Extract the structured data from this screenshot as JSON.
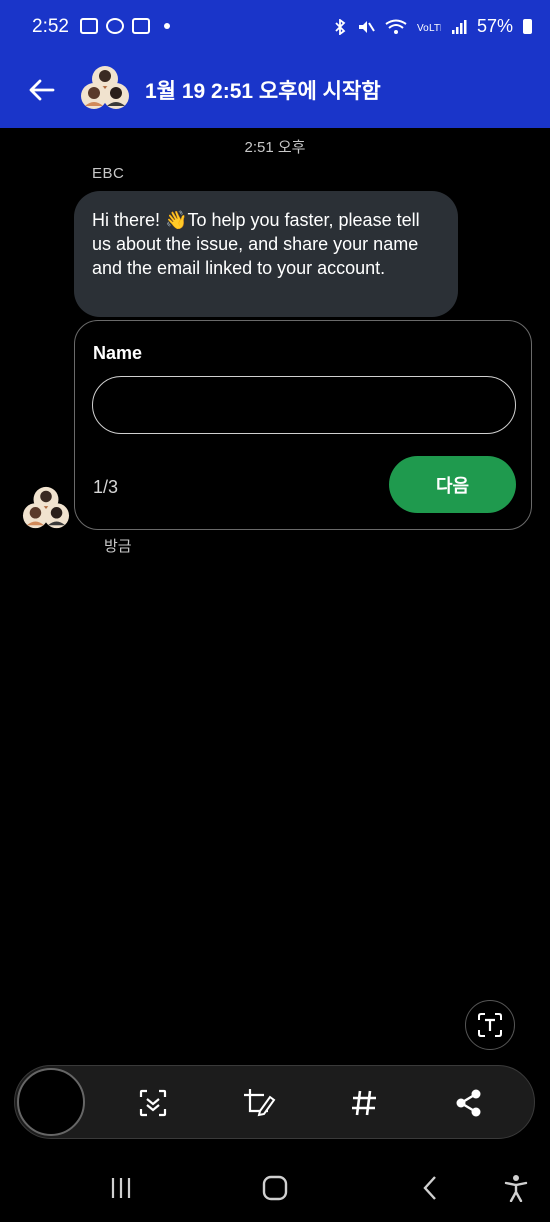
{
  "status_bar": {
    "time": "2:52",
    "battery": "57%",
    "icons": [
      "gallery-icon",
      "talk-icon",
      "voicemail-icon",
      "bluetooth-icon",
      "mute-icon",
      "wifi-icon",
      "volte-icon",
      "signal-icon",
      "battery-icon"
    ]
  },
  "header": {
    "title": "1월 19 2:51 오후에 시작함"
  },
  "chat": {
    "timestamp": "2:51 오후",
    "sender": "EBC",
    "message": "Hi there! 👋To help you faster, please tell us about the issue, and share your name and the email linked to your account.",
    "form": {
      "label": "Name",
      "value": "",
      "step": "1/3",
      "next_label": "다음"
    },
    "time_ago": "방금"
  },
  "colors": {
    "header_bg": "#1a35c9",
    "bubble_bg": "#2b3036",
    "accent_green": "#1f9a4e"
  }
}
